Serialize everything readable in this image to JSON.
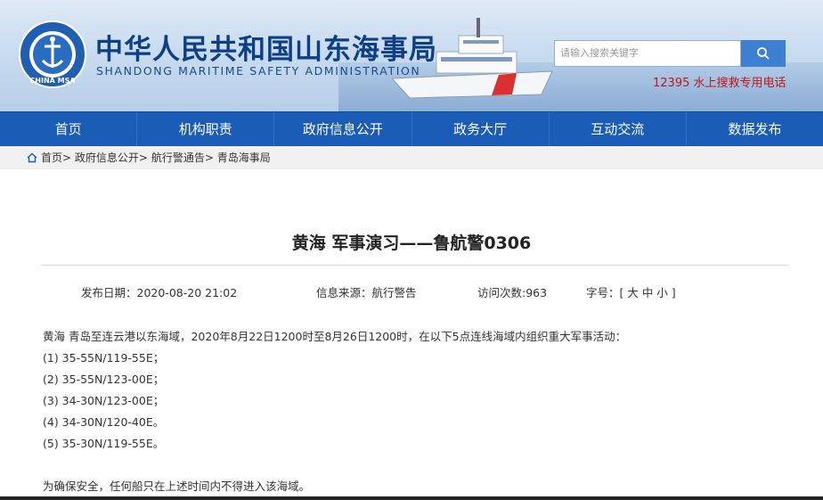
{
  "header": {
    "title_cn": "中华人民共和国山东海事局",
    "title_en": "SHANDONG MARITIME SAFETY ADMINISTRATION",
    "emblem_text": "CHINA MSA",
    "search_placeholder": "请输入搜索关键字",
    "hotline": "12395 水上搜救专用电话"
  },
  "nav": {
    "items": [
      "首页",
      "机构职责",
      "政府信息公开",
      "政务大厅",
      "互动交流",
      "数据发布"
    ]
  },
  "breadcrumb": {
    "home": "首页",
    "sep1": ">",
    "item1": "政府信息公开",
    "sep2": ">",
    "item2": "航行警通告",
    "sep3": ">",
    "item3": "青岛海事局"
  },
  "article": {
    "title": "黄海 军事演习——鲁航警0306",
    "publish_date": "发布日期：2020-08-20  21:02",
    "source": "信息来源：航行警告",
    "visits": "访问次数:963",
    "font_size_label": "字号：[ 大 中 小 ]",
    "intro": "黄海  青岛至连云港以东海域，2020年8月22日1200时至8月26日1200时，在以下5点连线海域内组织重大军事活动：",
    "points": [
      "(1) 35-55N/119-55E；",
      "(2) 35-55N/123-00E；",
      "(3) 34-30N/123-00E；",
      "(4) 34-30N/120-40E。",
      "(5) 35-30N/119-55E。"
    ],
    "notice": "为确保安全，任何船只在上述时间内不得进入该海域。"
  },
  "colors": {
    "nav_bg": "#1a5cb6",
    "title_blue": "#0e3f86",
    "hotline_red": "#c0141b",
    "search_btn": "#3d7fd0"
  }
}
